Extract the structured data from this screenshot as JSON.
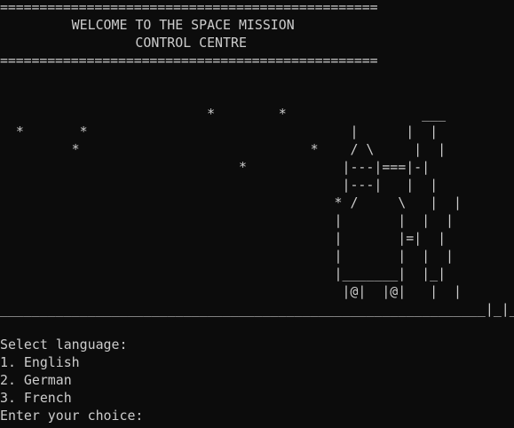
{
  "banner": {
    "top_rule": "================================================",
    "title_line_1": "         WELCOME TO THE SPACE MISSION",
    "title_line_2": "                 CONTROL CENTRE",
    "bottom_rule": "================================================"
  },
  "ascii_art": [
    "",
    "",
    "                          *        *                 ___",
    "  *       *                                 |      |  |",
    "         *                             *    / \\     |  |",
    "                              *            |---|===|-|",
    "                                           |---|   |  |",
    "                                          * /     \\   |  |",
    "                                          |       |  |  |",
    "                                          |       |=|  |",
    "                                          |       |  |  |",
    "                                          |_______|  |_|",
    "                                           |@|  |@|   |  |",
    "_____________________________________________________________|_|_"
  ],
  "menu": {
    "prompt": "Select language:",
    "options": [
      "1. English",
      "2. German",
      "3. French"
    ],
    "input_prompt": "Enter your choice:"
  }
}
